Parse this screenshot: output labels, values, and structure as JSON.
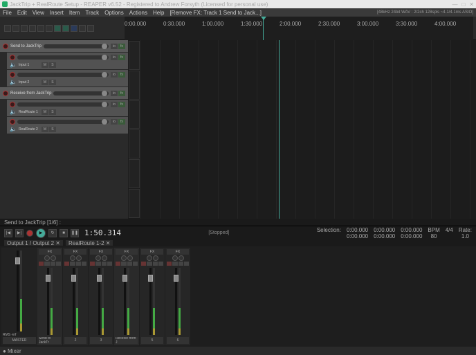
{
  "window": {
    "title": "JackTrip + RealRoute Setup - REAPER v6.52 - Registered to Andrew Forsyth (Licensed for personal use)",
    "audio_status": "[48kHz 24bit WAV : 2/2ch 128spls ~4.1/4.1ms ASIO]"
  },
  "menu": [
    "File",
    "Edit",
    "View",
    "Insert",
    "Item",
    "Track",
    "Options",
    "Actions",
    "Help",
    "[Remove FX: Track 1 Send to Jack...]"
  ],
  "ruler": [
    "0:00.000",
    "0:30.000",
    "1:00.000",
    "1:30.000",
    "2:00.000",
    "2:30.000",
    "3:00.000",
    "3:30.000",
    "4:00.000"
  ],
  "tracks": [
    {
      "name": "Send to JackTrip",
      "input": ""
    },
    {
      "name": "",
      "input": "Input 1"
    },
    {
      "name": "",
      "input": "Input 2"
    },
    {
      "name": "Receive from JackTrip",
      "input": ""
    },
    {
      "name": "",
      "input": "RealRoute 1"
    },
    {
      "name": "",
      "input": "RealRoute 2"
    }
  ],
  "route_bar": "Send to JackTrip [1/6] :",
  "transport": {
    "time": "1:50.314",
    "status": "[Stopped]",
    "sel_label": "Selection:",
    "sel_start": "0:00.000",
    "sel_start2": "0:00.000",
    "sel_end": "0:00.000",
    "sel_end2": "0:00.000",
    "sel_len": "0:00.000",
    "sel_len2": "0:00.000",
    "bpm_label": "BPM",
    "bpm": "80",
    "timesig": "4/4",
    "rate_label": "Rate:",
    "rate": "1.0"
  },
  "mixer_tabs": [
    "Output 1 / Output 2  ✕",
    "RealRoute 1-2  ✕"
  ],
  "mixer": {
    "master": {
      "label": "MASTER",
      "rms": "RMS -inf"
    },
    "channels": [
      {
        "label": "Send to JackTr",
        "fx": "FX"
      },
      {
        "label": "2",
        "fx": "FX"
      },
      {
        "label": "3",
        "fx": "FX"
      },
      {
        "label": "Receive from J",
        "fx": "FX"
      },
      {
        "label": "5",
        "fx": "FX"
      },
      {
        "label": "6",
        "fx": "FX"
      }
    ]
  },
  "statusbar": {
    "mixer": "● Mixer"
  }
}
